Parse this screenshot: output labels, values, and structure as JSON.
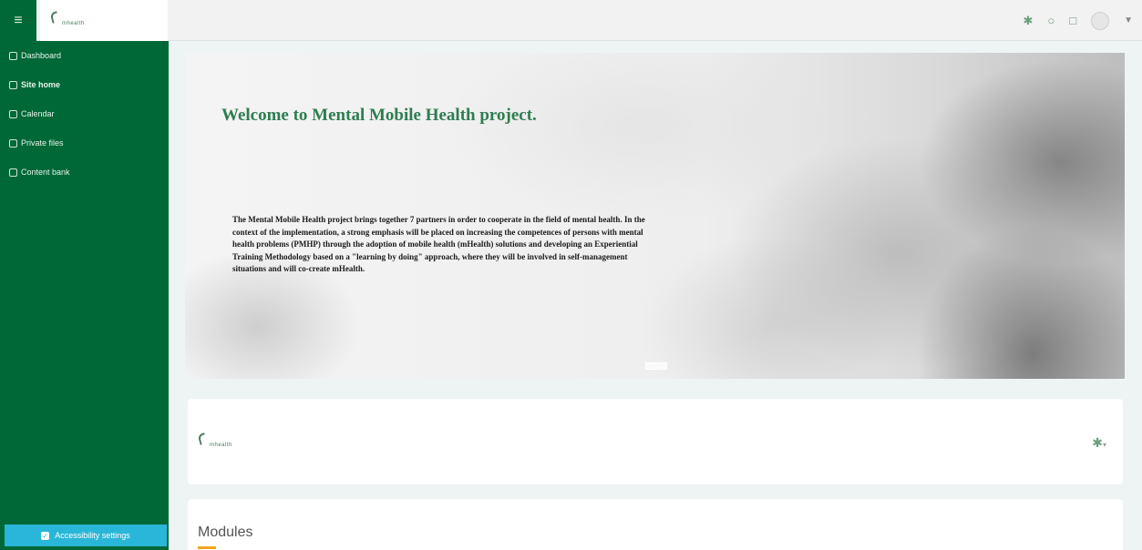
{
  "topbar": {
    "menu_icon": "hamburger-icon",
    "logo_text": "mhealth",
    "icons": [
      "gear-icon",
      "bell-icon",
      "chat-icon",
      "user-avatar",
      "chevron-down-icon"
    ]
  },
  "sidebar": {
    "items": [
      {
        "label": "Dashboard",
        "icon": "dashboard-icon"
      },
      {
        "label": "Site home",
        "icon": "home-icon"
      },
      {
        "label": "Calendar",
        "icon": "calendar-icon"
      },
      {
        "label": "Private files",
        "icon": "file-icon"
      },
      {
        "label": "Content bank",
        "icon": "content-bank-icon"
      }
    ],
    "accessibility_label": "Accessibility settings"
  },
  "hero": {
    "title": "Welcome to Mental Mobile Health project.",
    "text": "The Mental Mobile Health project brings together 7 partners in order to cooperate in the field of mental health. In the context of the implementation, a strong emphasis will be placed on increasing the competences of persons with mental health problems (PMHP) through the adoption of mobile health (mHealth) solutions and developing an Experiential Training Methodology based on a \"learning by doing\" approach, where they will be involved in self-management situations and will co-create mHealth."
  },
  "logo_card": {
    "logo_text": "mhealth"
  },
  "modules": {
    "title": "Modules"
  },
  "colors": {
    "sidebar": "#006837",
    "accent": "#29b6d8",
    "title_green": "#2e7d4f",
    "underline": "#f5a623"
  }
}
